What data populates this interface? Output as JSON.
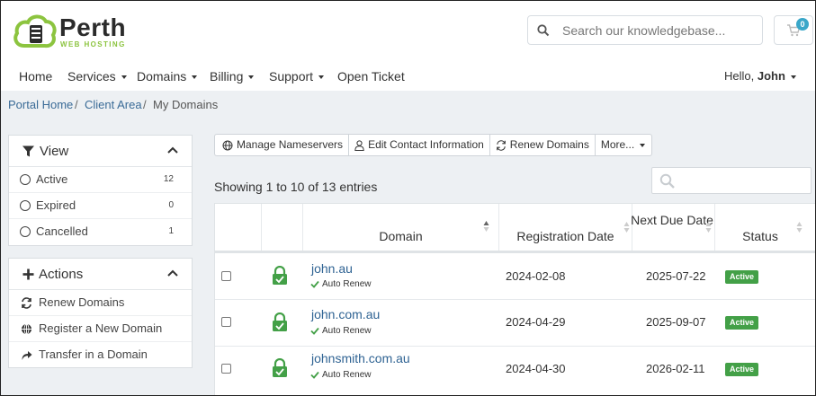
{
  "brand": {
    "name": "Perth",
    "tagline": "WEB HOSTING"
  },
  "header": {
    "search_placeholder": "Search our knowledgebase...",
    "cart_count": "0"
  },
  "nav": {
    "items": [
      {
        "label": "Home",
        "dropdown": false
      },
      {
        "label": "Services",
        "dropdown": true
      },
      {
        "label": "Domains",
        "dropdown": true
      },
      {
        "label": "Billing",
        "dropdown": true
      },
      {
        "label": "Support",
        "dropdown": true
      },
      {
        "label": "Open Ticket",
        "dropdown": false
      }
    ],
    "hello_prefix": "Hello,",
    "user": "John"
  },
  "breadcrumb": {
    "home": "Portal Home",
    "sep": "/",
    "client": "Client Area",
    "current": "My Domains"
  },
  "sidebar": {
    "view": {
      "title": "View",
      "items": [
        {
          "label": "Active",
          "count": "12"
        },
        {
          "label": "Expired",
          "count": "0"
        },
        {
          "label": "Cancelled",
          "count": "1"
        }
      ]
    },
    "actions": {
      "title": "Actions",
      "items": [
        {
          "label": "Renew Domains",
          "icon": "renew-icon"
        },
        {
          "label": "Register a New Domain",
          "icon": "globe-icon"
        },
        {
          "label": "Transfer in a Domain",
          "icon": "share-arrow-icon"
        }
      ]
    }
  },
  "toolbar": {
    "manage_ns": "Manage Nameservers",
    "edit_contact": "Edit Contact Information",
    "renew": "Renew Domains",
    "more": "More..."
  },
  "table": {
    "showing": "Showing 1 to 10 of 13 entries",
    "headers": {
      "domain": "Domain",
      "reg_date": "Registration Date",
      "next_due": "Next Due Date",
      "status": "Status"
    },
    "rows": [
      {
        "domain": "john.au",
        "auto_renew": "Auto Renew",
        "reg_date": "2024-02-08",
        "next_due": "2025-07-22",
        "status": "Active"
      },
      {
        "domain": "john.com.au",
        "auto_renew": "Auto Renew",
        "reg_date": "2024-04-29",
        "next_due": "2025-09-07",
        "status": "Active"
      },
      {
        "domain": "johnsmith.com.au",
        "auto_renew": "Auto Renew",
        "reg_date": "2024-04-30",
        "next_due": "2026-02-11",
        "status": "Active"
      }
    ]
  },
  "colors": {
    "brand_green": "#8cc43f",
    "link_blue": "#2f6393",
    "status_active": "#43a047",
    "badge_blue": "#3aa7c9"
  }
}
